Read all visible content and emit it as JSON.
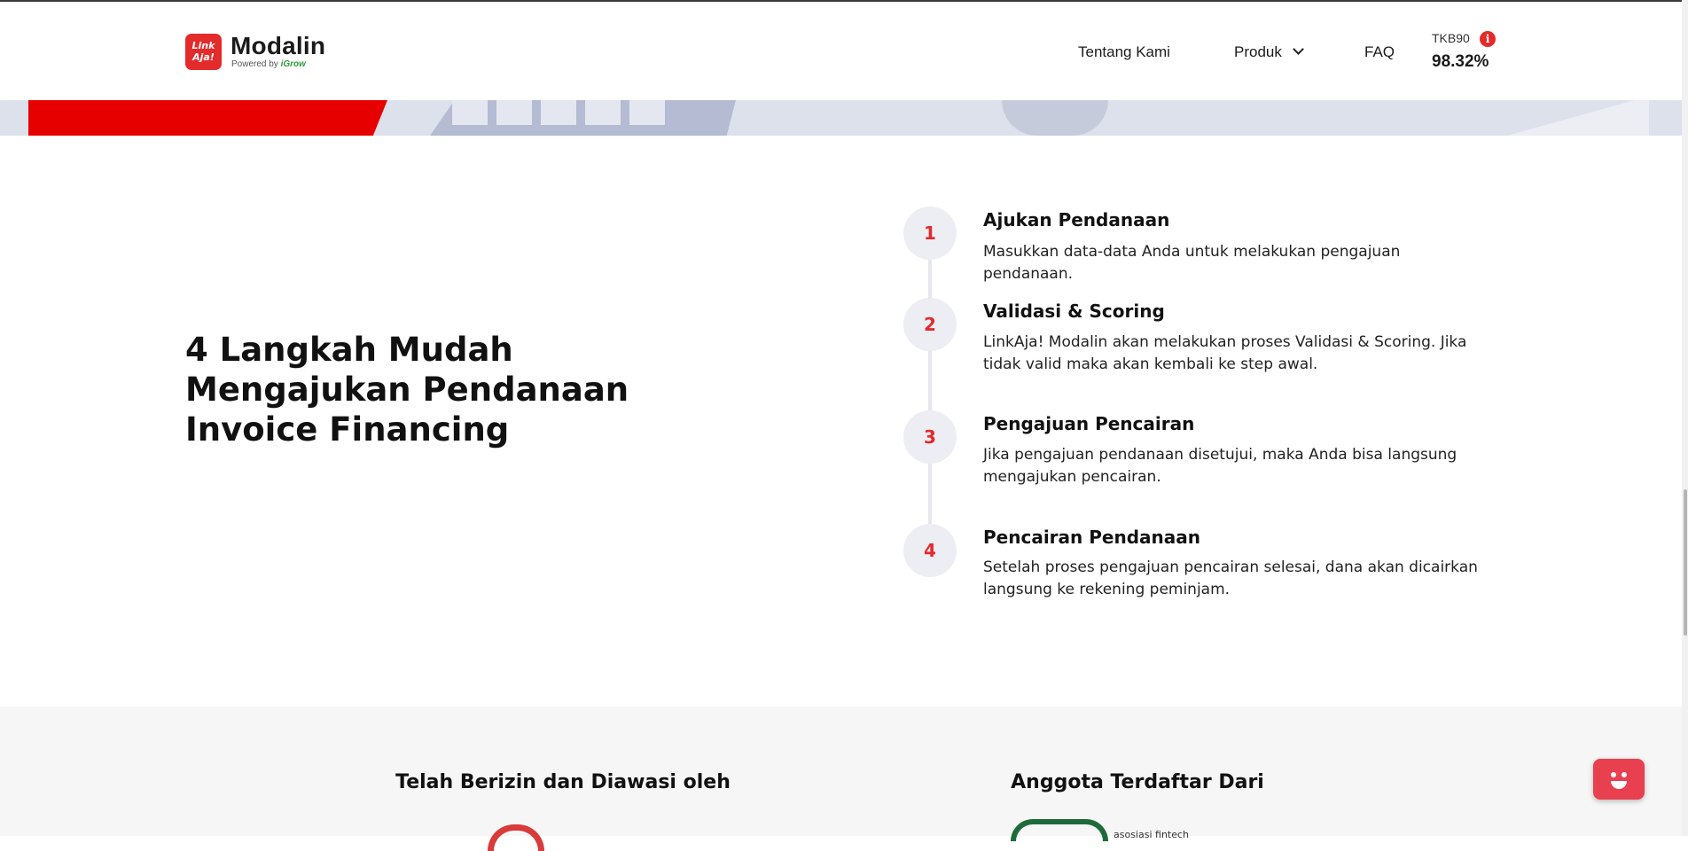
{
  "header": {
    "logo_badge_top": "Link",
    "logo_badge_bottom": "Aja!",
    "brand_name": "Modalin",
    "powered_by": "Powered by",
    "powered_brand": "iGrow",
    "nav": {
      "about": "Tentang Kami",
      "product": "Produk",
      "faq": "FAQ"
    },
    "tkb": {
      "label": "TKB90",
      "info_icon": "i",
      "value": "98.32%"
    }
  },
  "steps_section": {
    "title": "4 Langkah Mudah Mengajukan Pendanaan Invoice Financing",
    "steps": [
      {
        "number": "1",
        "title": "Ajukan Pendanaan",
        "description": "Masukkan data-data Anda untuk melakukan pengajuan pendanaan."
      },
      {
        "number": "2",
        "title": "Validasi & Scoring",
        "description": "LinkAja! Modalin akan melakukan proses Validasi & Scoring. Jika tidak valid maka akan kembali ke step awal."
      },
      {
        "number": "3",
        "title": "Pengajuan Pencairan",
        "description": "Jika pengajuan pendanaan disetujui, maka Anda bisa langsung mengajukan pencairan."
      },
      {
        "number": "4",
        "title": "Pencairan Pendanaan",
        "description": "Setelah proses pengajuan pencairan selesai, dana akan dicairkan langsung ke rekening peminjam."
      }
    ]
  },
  "footer_section": {
    "licensed_title": "Telah Berizin dan Diawasi oleh",
    "member_title": "Anggota Terdaftar Dari",
    "member_logo_text": "asosiasi fintech"
  },
  "colors": {
    "accent": "#e32b2b",
    "hero_red": "#e60000",
    "step_circle_bg": "#ededf4"
  },
  "icons": {
    "info": "info-icon",
    "chevron": "chevron-down-icon",
    "chat": "chat-bot-icon"
  }
}
